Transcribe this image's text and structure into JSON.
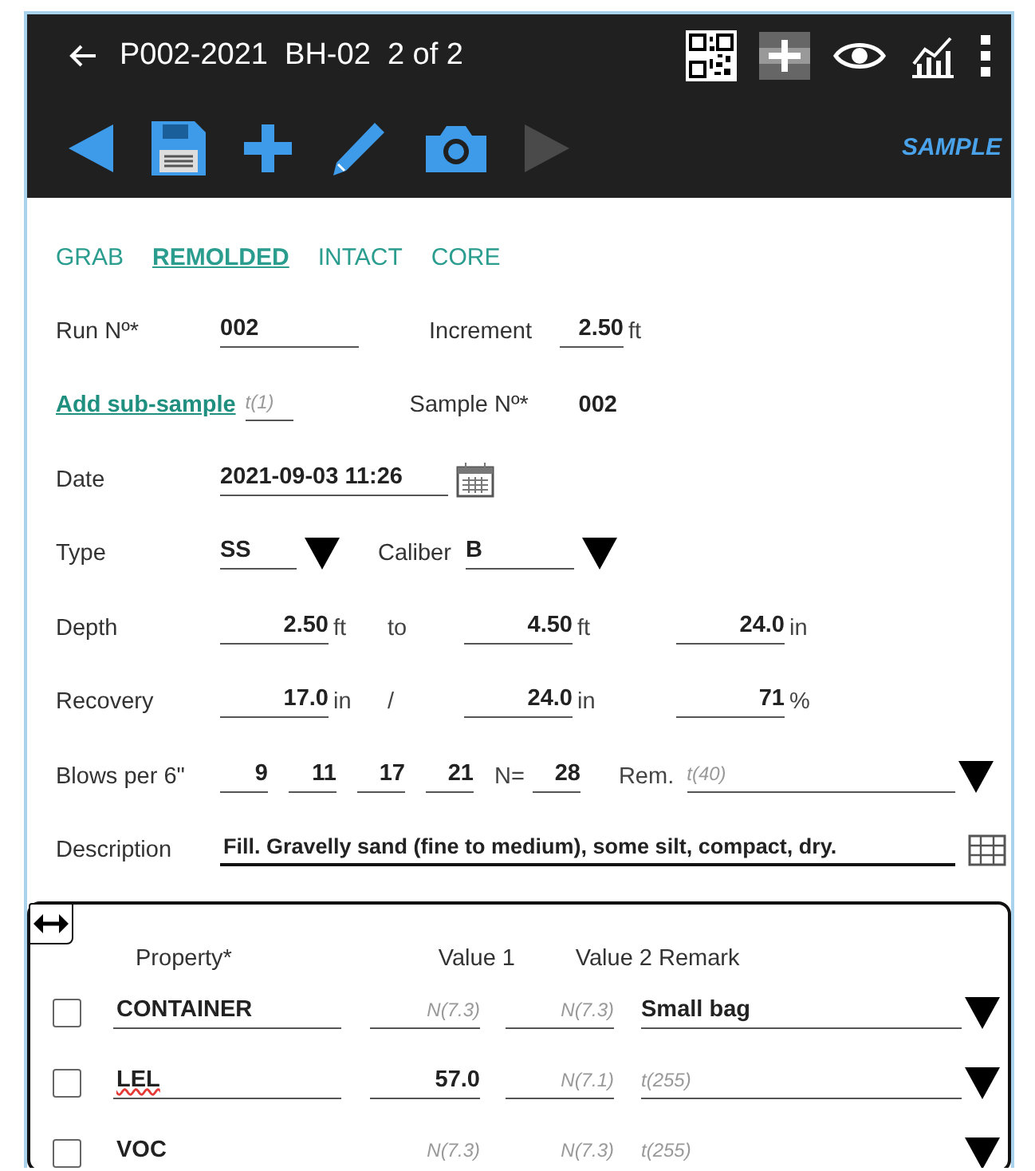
{
  "header": {
    "title": "P002-2021  BH-02  2 of 2"
  },
  "toolbar": {
    "label": "SAMPLE",
    "next_disabled": true
  },
  "sample_types": [
    {
      "label": "GRAB",
      "selected": false
    },
    {
      "label": "REMOLDED",
      "selected": true
    },
    {
      "label": "INTACT",
      "selected": false
    },
    {
      "label": "CORE",
      "selected": false
    }
  ],
  "run": {
    "label": "Run Nº*",
    "value": "002"
  },
  "increment": {
    "label": "Increment",
    "value": "2.50",
    "unit": "ft"
  },
  "sub_sample": {
    "link": "Add sub-sample",
    "placeholder": "t(1)"
  },
  "sample_no": {
    "label": "Sample Nº*",
    "value": "002"
  },
  "date": {
    "label": "Date",
    "value": "2021-09-03 11:26"
  },
  "type": {
    "label": "Type",
    "value": "SS"
  },
  "caliber": {
    "label": "Caliber",
    "value": "B"
  },
  "measure_rows": [
    {
      "label": "Depth",
      "items": [
        {
          "kind": "value",
          "value": "2.50",
          "unit": "ft"
        },
        {
          "kind": "sep",
          "text": "to"
        },
        {
          "kind": "value",
          "value": "4.50",
          "unit": "ft"
        },
        {
          "kind": "value",
          "value": "24.0",
          "unit": "in"
        }
      ]
    },
    {
      "label": "Recovery",
      "items": [
        {
          "kind": "value",
          "value": "17.0",
          "unit": "in"
        },
        {
          "kind": "sep",
          "text": "/"
        },
        {
          "kind": "value",
          "value": "24.0",
          "unit": "in"
        },
        {
          "kind": "value",
          "value": "71",
          "unit": "%"
        }
      ]
    }
  ],
  "blows": {
    "label": "Blows per 6\"",
    "counts": [
      "9",
      "11",
      "17",
      "21"
    ],
    "n_label": "N=",
    "n": "28",
    "remark_label": "Rem.",
    "remark_placeholder": "t(40)"
  },
  "description": {
    "label": "Description",
    "value": "Fill. Gravelly sand (fine to medium), some silt, compact, dry."
  },
  "property_table": {
    "columns": [
      "Property*",
      "Value 1",
      "Value 2",
      "Remark"
    ],
    "rows": [
      {
        "checked": false,
        "property": "CONTAINER",
        "misspelled": false,
        "value_1": {
          "placeholder": "N(7.3)"
        },
        "value_2": {
          "placeholder": "N(7.3)"
        },
        "remark": {
          "value": "Small bag"
        }
      },
      {
        "checked": false,
        "property": "LEL",
        "misspelled": true,
        "value_1": {
          "value": "57.0"
        },
        "value_2": {
          "placeholder": "N(7.1)"
        },
        "remark": {
          "placeholder": "t(255)"
        }
      },
      {
        "checked": false,
        "property": "VOC",
        "misspelled": false,
        "value_1": {
          "placeholder": "N(7.3)"
        },
        "value_2": {
          "placeholder": "N(7.3)"
        },
        "remark": {
          "placeholder": "t(255)"
        }
      }
    ]
  }
}
